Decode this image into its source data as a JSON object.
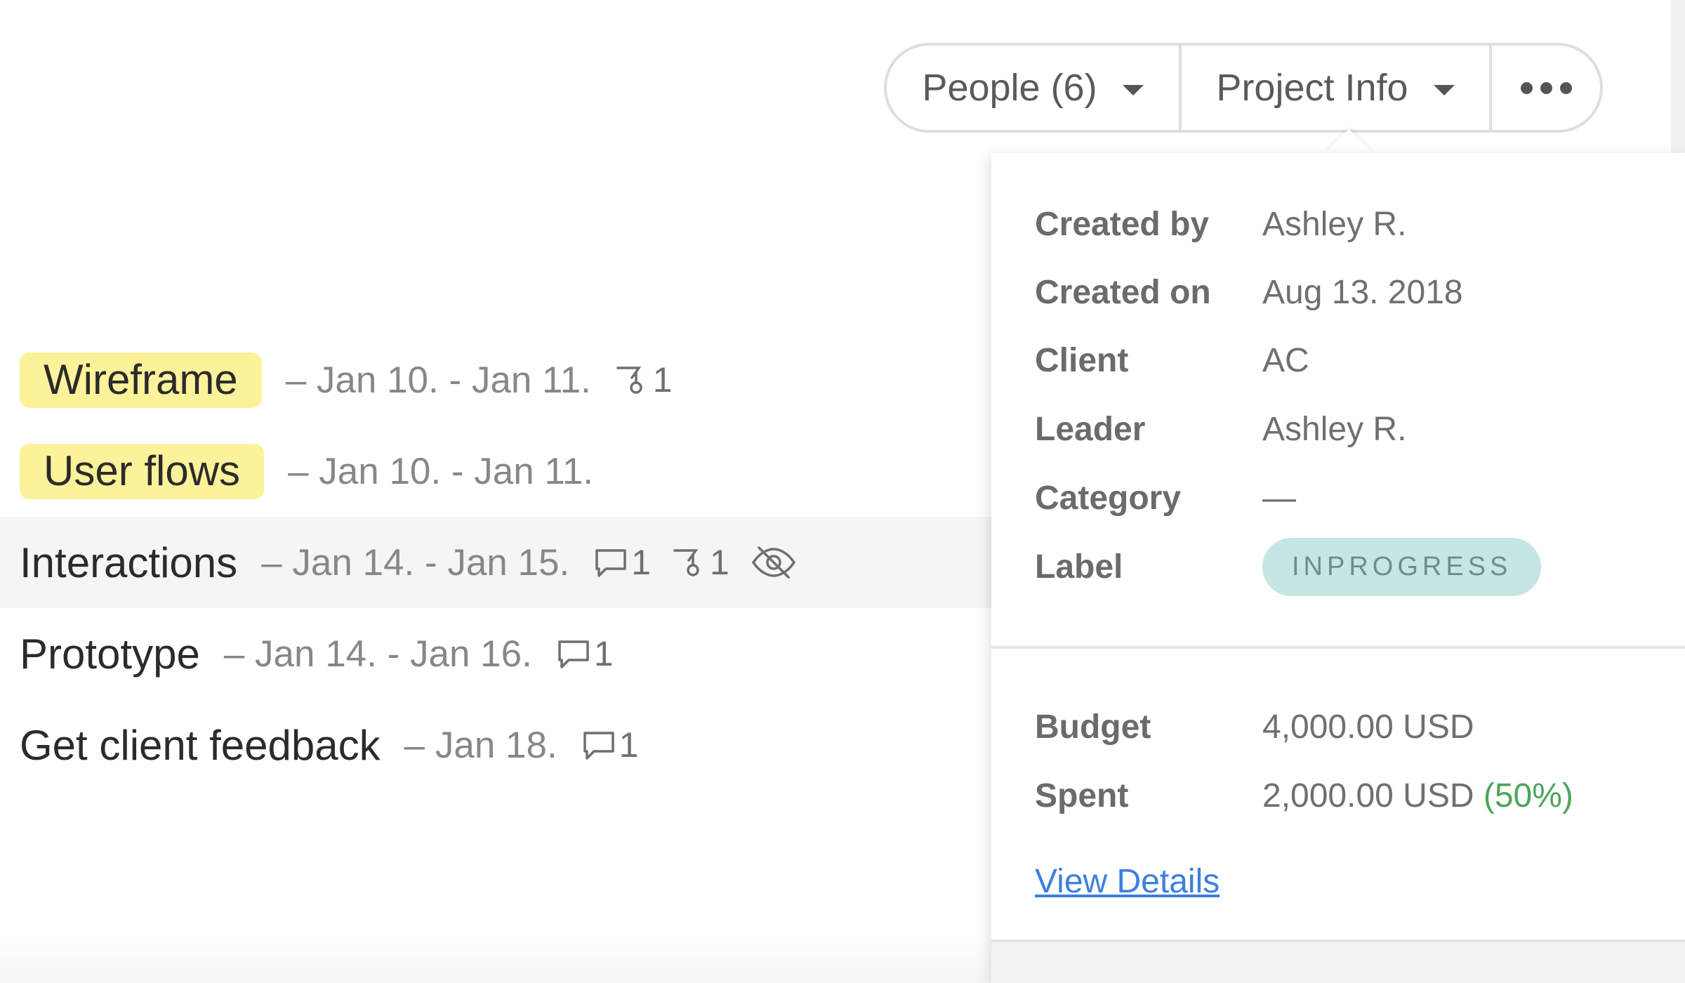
{
  "toolbar": {
    "people_label": "People (6)",
    "project_info_label": "Project Info",
    "more_icon": "more-horizontal-icon"
  },
  "tasks": [
    {
      "name": "Wireframe",
      "dates": "– Jan 10. - Jan 11.",
      "tagged": true,
      "tag_color": "#fcf29a",
      "comments": null,
      "dependencies": "1",
      "hidden": false
    },
    {
      "name": "User flows",
      "dates": "– Jan 10. - Jan 11.",
      "tagged": true,
      "tag_color": "#fcf29a",
      "comments": null,
      "dependencies": null,
      "hidden": false
    },
    {
      "name": "Interactions",
      "dates": "– Jan 14. - Jan 15.",
      "tagged": false,
      "comments": "1",
      "dependencies": "1",
      "hidden": true
    },
    {
      "name": "Prototype",
      "dates": "– Jan 14. - Jan 16.",
      "tagged": false,
      "comments": "1",
      "dependencies": null,
      "hidden": false
    },
    {
      "name": "Get client feedback",
      "dates": "– Jan 18.",
      "tagged": false,
      "comments": "1",
      "dependencies": null,
      "hidden": false
    }
  ],
  "project_info": {
    "fields": [
      {
        "label": "Created by",
        "value": "Ashley R."
      },
      {
        "label": "Created on",
        "value": "Aug 13. 2018"
      },
      {
        "label": "Client",
        "value": "AC"
      },
      {
        "label": "Leader",
        "value": "Ashley R."
      },
      {
        "label": "Category",
        "value": "—"
      },
      {
        "label": "Label",
        "value": "INPROGRESS"
      }
    ],
    "budget": {
      "label": "Budget",
      "value": "4,000.00 USD"
    },
    "spent": {
      "label": "Spent",
      "value": "2,000.00 USD",
      "percent": "(50%)"
    },
    "view_details": "View Details",
    "colors": {
      "label_pill_bg": "#c5e6e2",
      "percent_green": "#4da55c",
      "link_blue": "#3d7fe0"
    }
  }
}
